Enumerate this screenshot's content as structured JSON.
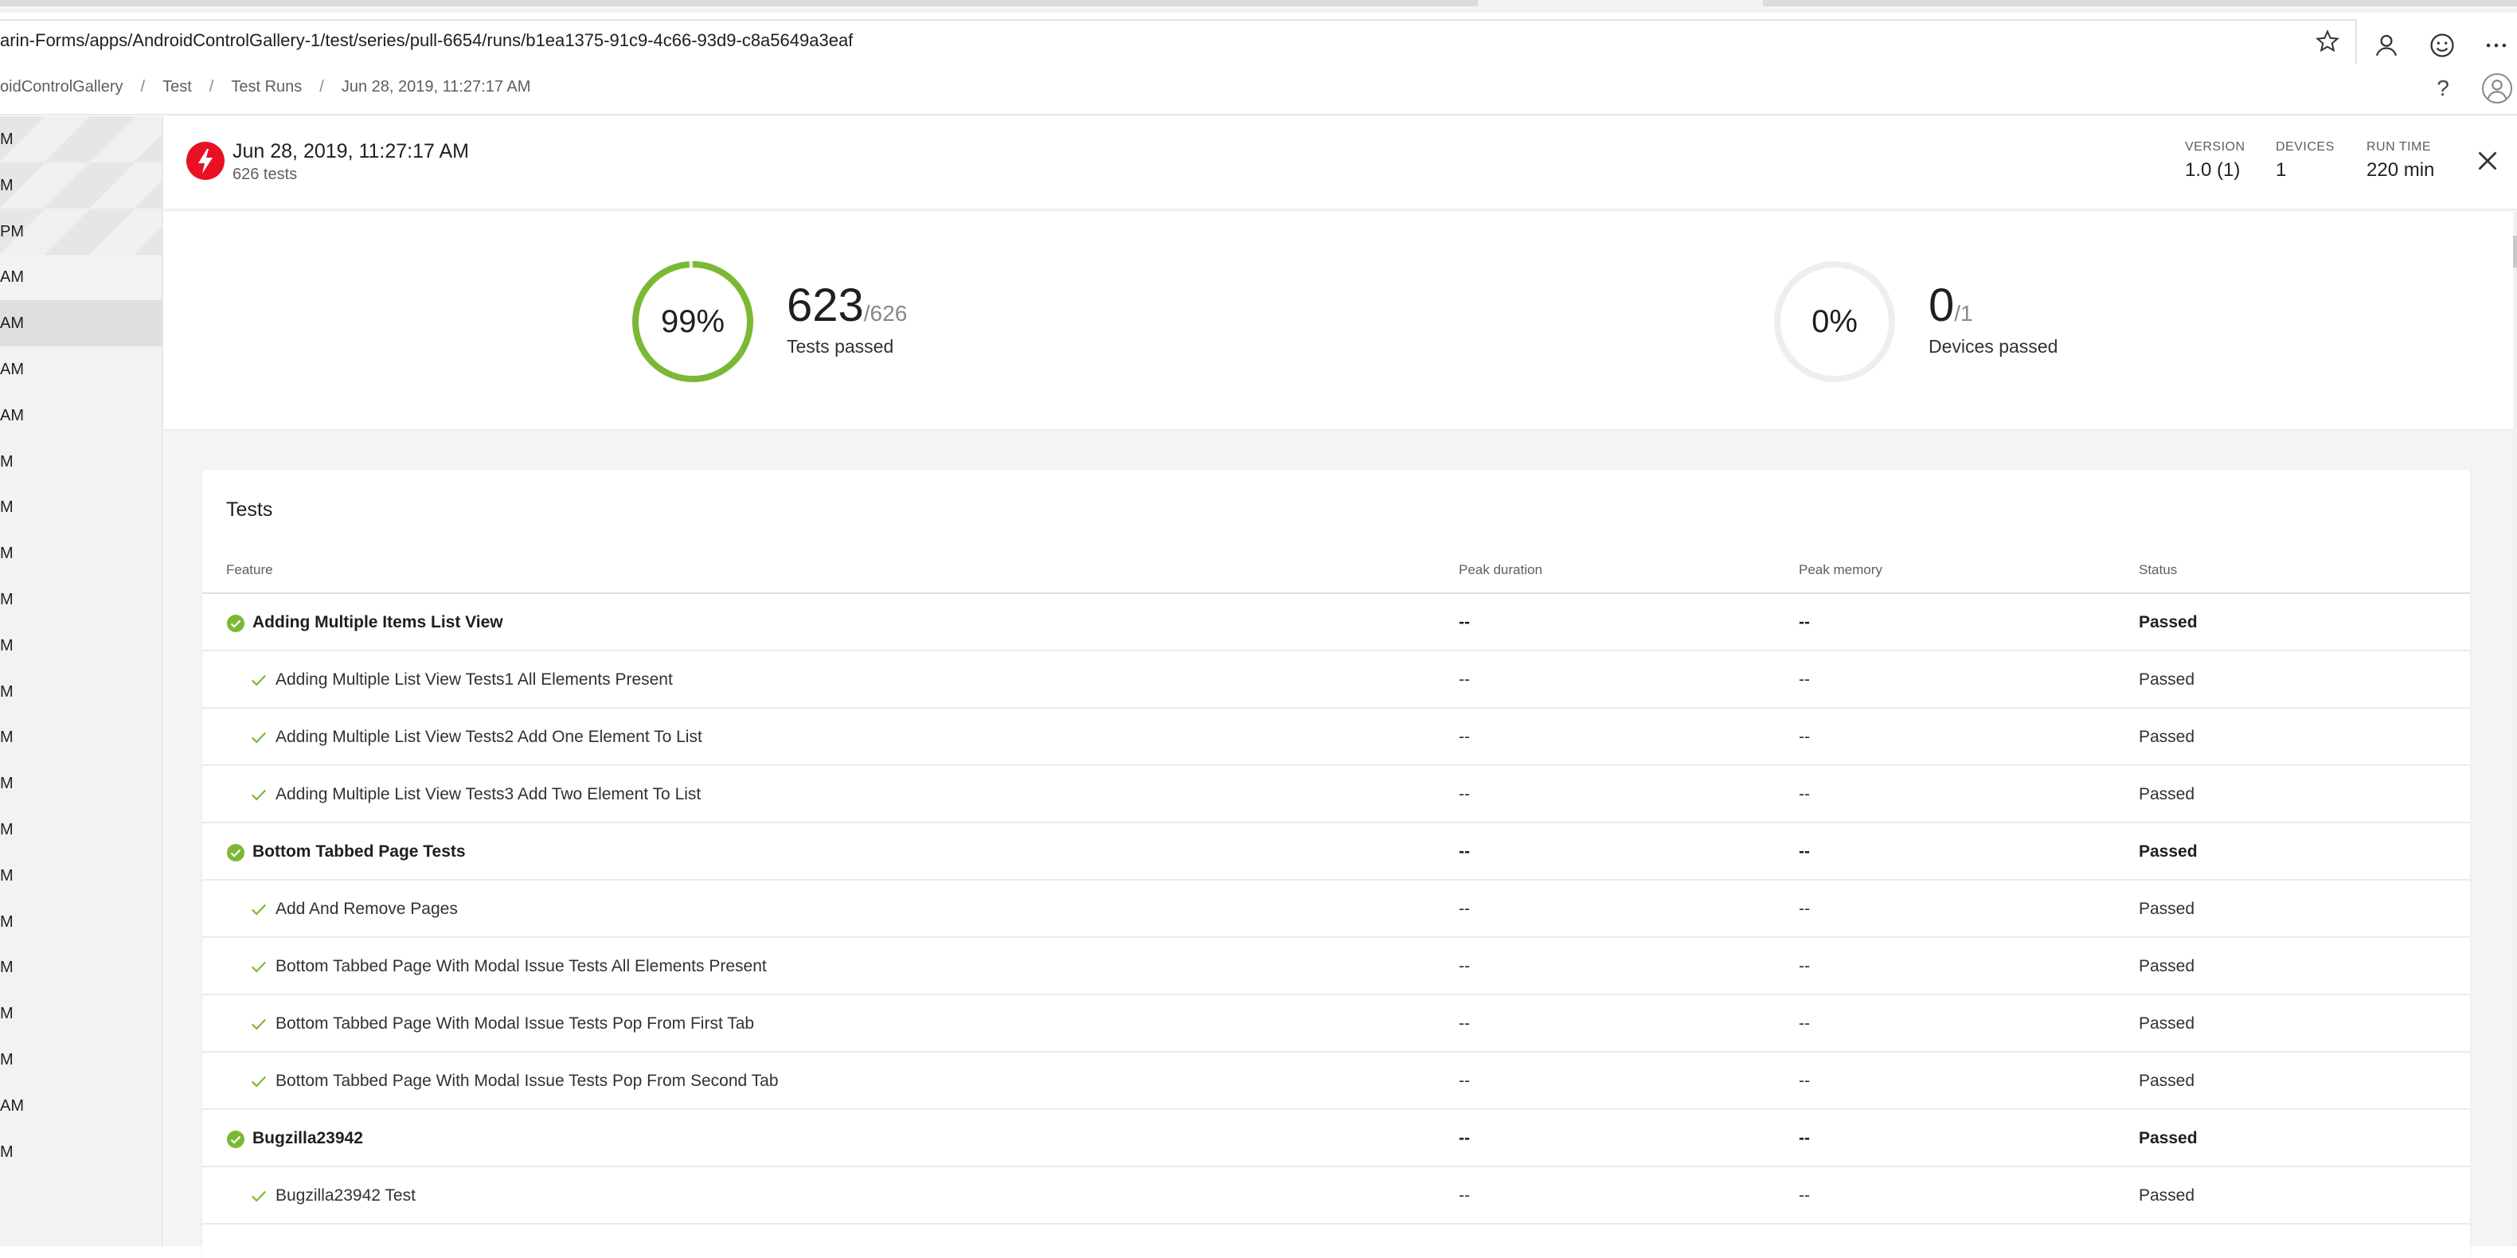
{
  "browser": {
    "url": "arin-Forms/apps/AndroidControlGallery-1/test/series/pull-6654/runs/b1ea1375-91c9-4c66-93d9-c8a5649a3eaf"
  },
  "breadcrumb": [
    "oidControlGallery",
    "Test",
    "Test Runs",
    "Jun 28, 2019, 11:27:17 AM"
  ],
  "left_list": [
    "M",
    "M",
    "PM",
    "AM",
    "AM",
    "AM",
    "AM",
    "M",
    "M",
    "M",
    "M",
    "M",
    "M",
    "M",
    "M",
    "M",
    "M",
    "M",
    "M",
    "M",
    "M",
    "AM",
    "M"
  ],
  "run": {
    "title": "Jun 28, 2019, 11:27:17 AM",
    "subtitle": "626 tests",
    "version_label": "VERSION",
    "version_value": "1.0 (1)",
    "devices_label": "DEVICES",
    "devices_value": "1",
    "runtime_label": "RUN TIME",
    "runtime_value": "220 min"
  },
  "summary": {
    "tests_percent": "99%",
    "tests_percent_value": 0.99,
    "tests_passed": "623",
    "tests_total": "/626",
    "tests_label": "Tests passed",
    "devices_percent": "0%",
    "devices_percent_value": 0,
    "devices_passed": "0",
    "devices_total": "/1",
    "devices_label": "Devices passed"
  },
  "tests": {
    "title": "Tests",
    "columns": [
      "Feature",
      "Peak duration",
      "Peak memory",
      "Status"
    ],
    "rows": [
      {
        "type": "group",
        "feature": "Adding Multiple Items List View",
        "duration": "--",
        "memory": "--",
        "status": "Passed"
      },
      {
        "type": "test",
        "feature": "Adding Multiple List View Tests1 All Elements Present",
        "duration": "--",
        "memory": "--",
        "status": "Passed"
      },
      {
        "type": "test",
        "feature": "Adding Multiple List View Tests2 Add One Element To List",
        "duration": "--",
        "memory": "--",
        "status": "Passed"
      },
      {
        "type": "test",
        "feature": "Adding Multiple List View Tests3 Add Two Element To List",
        "duration": "--",
        "memory": "--",
        "status": "Passed"
      },
      {
        "type": "group",
        "feature": "Bottom Tabbed Page Tests",
        "duration": "--",
        "memory": "--",
        "status": "Passed"
      },
      {
        "type": "test",
        "feature": "Add And Remove Pages",
        "duration": "--",
        "memory": "--",
        "status": "Passed"
      },
      {
        "type": "test",
        "feature": "Bottom Tabbed Page With Modal Issue Tests All Elements Present",
        "duration": "--",
        "memory": "--",
        "status": "Passed"
      },
      {
        "type": "test",
        "feature": "Bottom Tabbed Page With Modal Issue Tests Pop From First Tab",
        "duration": "--",
        "memory": "--",
        "status": "Passed"
      },
      {
        "type": "test",
        "feature": "Bottom Tabbed Page With Modal Issue Tests Pop From Second Tab",
        "duration": "--",
        "memory": "--",
        "status": "Passed"
      },
      {
        "type": "group",
        "feature": "Bugzilla23942",
        "duration": "--",
        "memory": "--",
        "status": "Passed"
      },
      {
        "type": "test",
        "feature": "Bugzilla23942 Test",
        "duration": "--",
        "memory": "--",
        "status": "Passed"
      }
    ]
  },
  "colors": {
    "pass_green": "#7bb935",
    "error_red": "#e81123",
    "ring_track": "#eeeeee"
  },
  "icons": [
    "star-icon",
    "profile-icon",
    "feedback-icon",
    "more-icon",
    "help-icon",
    "avatar-icon",
    "run-failed-icon",
    "close-icon",
    "passed-circle-icon",
    "checkmark-icon"
  ]
}
